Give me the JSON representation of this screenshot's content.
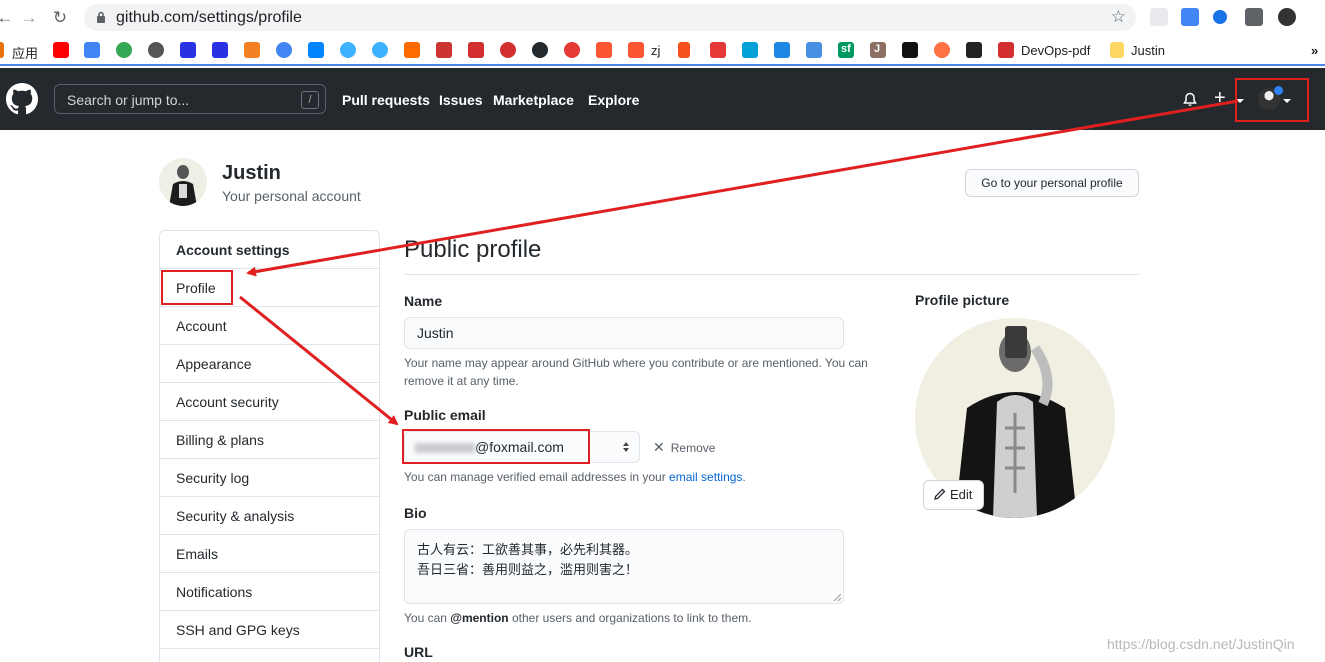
{
  "browser": {
    "url": "github.com/settings/profile",
    "bookmarks": {
      "apps_label": "应用",
      "zj_label": "zj",
      "sf_label": "sf",
      "j_label": "J",
      "devops_label": "DevOps-pdf",
      "justin_label": "Justin"
    }
  },
  "header": {
    "search_placeholder": "Search or jump to...",
    "search_hotkey": "/",
    "nav": [
      "Pull requests",
      "Issues",
      "Marketplace",
      "Explore"
    ]
  },
  "account": {
    "name": "Justin",
    "subtitle": "Your personal account",
    "profile_button": "Go to your personal profile"
  },
  "sidebar": {
    "heading": "Account settings",
    "items": [
      "Profile",
      "Account",
      "Appearance",
      "Account security",
      "Billing & plans",
      "Security log",
      "Security & analysis",
      "Emails",
      "Notifications",
      "SSH and GPG keys"
    ]
  },
  "main": {
    "title": "Public profile",
    "name_label": "Name",
    "name_value": "Justin",
    "name_note": "Your name may appear around GitHub where you contribute or are mentioned. You can remove it at any time.",
    "email_label": "Public email",
    "email_value": "@foxmail.com",
    "email_remove": "Remove",
    "email_note_prefix": "You can manage verified email addresses in your ",
    "email_note_link": "email settings",
    "email_note_suffix": ".",
    "bio_label": "Bio",
    "bio_line1": "古人有云：工欲善其事，必先利其器。",
    "bio_line2": "吾日三省：善用则益之，滥用则害之！",
    "bio_note_prefix": "You can ",
    "bio_note_mention": "@mention",
    "bio_note_suffix": " other users and organizations to link to them.",
    "url_label": "URL",
    "picture_label": "Profile picture",
    "picture_edit": "Edit"
  },
  "watermark": "https://blog.csdn.net/JustinQin",
  "colors": {
    "header_bg": "#24292e",
    "link": "#0366d6",
    "annotation_red": "#e02020"
  }
}
